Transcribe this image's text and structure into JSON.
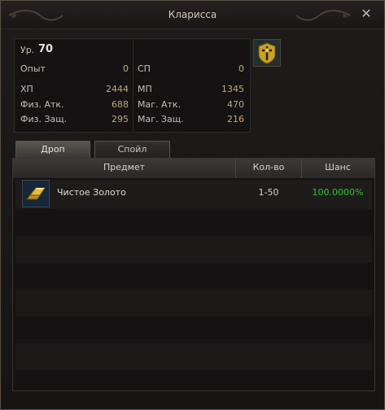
{
  "window": {
    "title": "Кларисса",
    "close_label": "✕"
  },
  "stats": {
    "level_label": "Ур.",
    "level": "70",
    "exp_label": "Опыт",
    "exp": "0",
    "sp_label": "СП",
    "sp": "0",
    "hp_label": "ХП",
    "hp": "2444",
    "mp_label": "МП",
    "mp": "1345",
    "patk_label": "Физ. Атк.",
    "patk": "688",
    "matk_label": "Маг. Атк.",
    "matk": "470",
    "pdef_label": "Физ. Защ.",
    "pdef": "295",
    "mdef_label": "Маг. Защ.",
    "mdef": "216"
  },
  "tabs": [
    {
      "label": "Дроп",
      "active": true
    },
    {
      "label": "Спойл",
      "active": false
    }
  ],
  "table": {
    "headers": [
      "Предмет",
      "Кол-во",
      "Шанс"
    ],
    "rows": [
      {
        "icon": "gold-bar-icon",
        "name": "Чистое Золото",
        "qty": "1-50",
        "chance": "100.0000%"
      }
    ]
  },
  "colors": {
    "chance_green": "#2fc42f",
    "stat_value": "#c2a885"
  }
}
